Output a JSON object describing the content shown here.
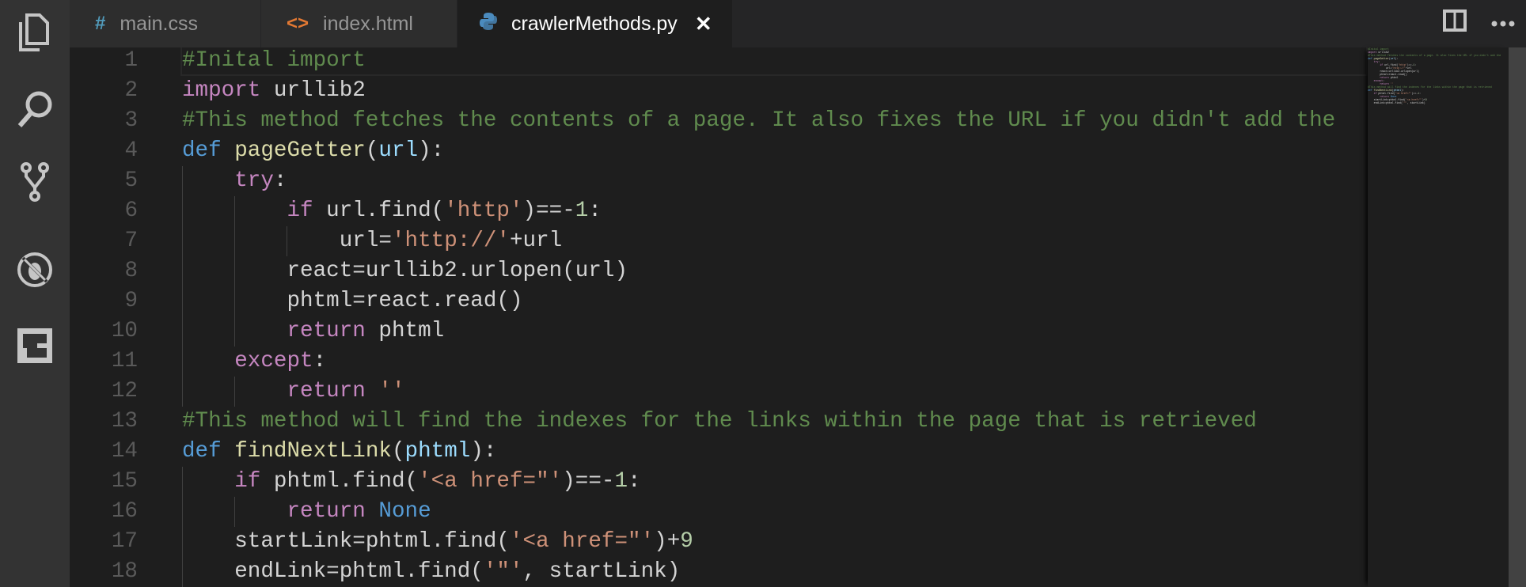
{
  "activity_bar": {
    "items": [
      {
        "icon": "files-icon"
      },
      {
        "icon": "search-icon"
      },
      {
        "icon": "source-control-icon"
      },
      {
        "icon": "debug-icon"
      },
      {
        "icon": "extensions-icon"
      }
    ]
  },
  "tabs": [
    {
      "label": "main.css",
      "icon": "#",
      "icon_color": "#519aba",
      "active": false
    },
    {
      "label": "index.html",
      "icon": "<>",
      "icon_color": "#e37933",
      "active": false
    },
    {
      "label": "crawlerMethods.py",
      "icon": "python",
      "icon_color": "#4b8bbe",
      "active": true,
      "close": "✕"
    }
  ],
  "editor": {
    "lines": [
      {
        "n": "1",
        "indent": 0,
        "t": [
          [
            "c",
            "#Inital import"
          ]
        ]
      },
      {
        "n": "2",
        "indent": 0,
        "t": [
          [
            "k",
            "import"
          ],
          [
            "p",
            " urllib2"
          ]
        ]
      },
      {
        "n": "3",
        "indent": 0,
        "t": [
          [
            "c",
            "#This method fetches the contents of a page. It also fixes the URL if you didn't add the"
          ]
        ]
      },
      {
        "n": "4",
        "indent": 0,
        "t": [
          [
            "d",
            "def"
          ],
          [
            "p",
            " "
          ],
          [
            "f",
            "pageGetter"
          ],
          [
            "p",
            "("
          ],
          [
            "v",
            "url"
          ],
          [
            "p",
            "):"
          ]
        ]
      },
      {
        "n": "5",
        "indent": 1,
        "t": [
          [
            "k",
            "try"
          ],
          [
            "p",
            ":"
          ]
        ]
      },
      {
        "n": "6",
        "indent": 2,
        "t": [
          [
            "k",
            "if"
          ],
          [
            "p",
            " url.find("
          ],
          [
            "s",
            "'http'"
          ],
          [
            "p",
            ")==-"
          ],
          [
            "n",
            "1"
          ],
          [
            "p",
            ":"
          ]
        ]
      },
      {
        "n": "7",
        "indent": 3,
        "t": [
          [
            "p",
            "url="
          ],
          [
            "s",
            "'http://'"
          ],
          [
            "p",
            "+url"
          ]
        ]
      },
      {
        "n": "8",
        "indent": 2,
        "t": [
          [
            "p",
            "react=urllib2.urlopen(url)"
          ]
        ]
      },
      {
        "n": "9",
        "indent": 2,
        "t": [
          [
            "p",
            "phtml=react.read()"
          ]
        ]
      },
      {
        "n": "10",
        "indent": 2,
        "t": [
          [
            "k",
            "return"
          ],
          [
            "p",
            " phtml"
          ]
        ]
      },
      {
        "n": "11",
        "indent": 1,
        "t": [
          [
            "k",
            "except"
          ],
          [
            "p",
            ":"
          ]
        ]
      },
      {
        "n": "12",
        "indent": 2,
        "t": [
          [
            "k",
            "return"
          ],
          [
            "p",
            " "
          ],
          [
            "s",
            "''"
          ]
        ]
      },
      {
        "n": "13",
        "indent": 0,
        "t": [
          [
            "c",
            "#This method will find the indexes for the links within the page that is retrieved"
          ]
        ]
      },
      {
        "n": "14",
        "indent": 0,
        "t": [
          [
            "d",
            "def"
          ],
          [
            "p",
            " "
          ],
          [
            "f",
            "findNextLink"
          ],
          [
            "p",
            "("
          ],
          [
            "v",
            "phtml"
          ],
          [
            "p",
            "):"
          ]
        ]
      },
      {
        "n": "15",
        "indent": 1,
        "t": [
          [
            "k",
            "if"
          ],
          [
            "p",
            " phtml.find("
          ],
          [
            "s",
            "'<a href=\"'"
          ],
          [
            "p",
            ")==-"
          ],
          [
            "n",
            "1"
          ],
          [
            "p",
            ":"
          ]
        ]
      },
      {
        "n": "16",
        "indent": 2,
        "t": [
          [
            "k",
            "return"
          ],
          [
            "p",
            " "
          ],
          [
            "d",
            "None"
          ]
        ]
      },
      {
        "n": "17",
        "indent": 1,
        "t": [
          [
            "p",
            "startLink=phtml.find("
          ],
          [
            "s",
            "'<a href=\"'"
          ],
          [
            "p",
            ")+"
          ],
          [
            "n",
            "9"
          ]
        ]
      },
      {
        "n": "18",
        "indent": 1,
        "t": [
          [
            "p",
            "endLink=phtml.find("
          ],
          [
            "s",
            "'\"'"
          ],
          [
            "p",
            ", startLink)"
          ]
        ]
      }
    ]
  },
  "colors": {
    "activity": "#333333",
    "editor_bg": "#1e1e1e",
    "comment": "#608b4e",
    "keyword": "#c586c0",
    "storage": "#569cd6",
    "function": "#dcdcaa",
    "string": "#ce9178",
    "number": "#b5cea8"
  }
}
